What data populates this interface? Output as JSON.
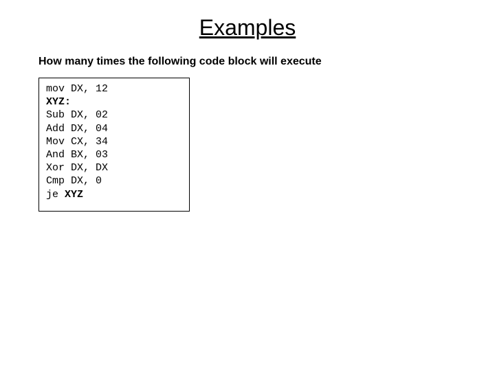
{
  "title": "Examples",
  "question": "How many times the following code block will execute",
  "code": {
    "l1a": "mov DX, 12",
    "l2a": "XYZ:",
    "l3a": "Sub DX, 02",
    "l4a": "Add DX, 04",
    "l5a": "Mov CX, 34",
    "l6a": "And BX, 03",
    "l7a": "Xor DX, DX",
    "l8a": "Cmp DX, 0",
    "l9a": "je ",
    "l9b": "XYZ"
  }
}
